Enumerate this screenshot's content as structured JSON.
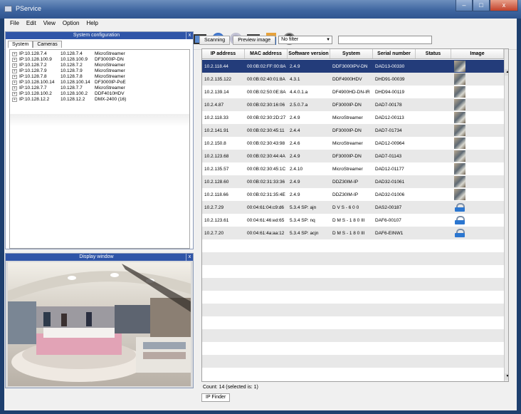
{
  "window": {
    "title": "PService",
    "min": "–",
    "max": "□",
    "close": "x"
  },
  "menu": [
    "File",
    "Edit",
    "View",
    "Option",
    "Help"
  ],
  "toolbar_icons": [
    "save-icon",
    "new-document-icon",
    "cancel-icon",
    "pencil-icon",
    "lines-icon",
    "camera-icon",
    "robot-arm-icon",
    "satellite-icon",
    "network-icon",
    "display-icon",
    "monitor-icon",
    "globe-icon",
    "disc-icon",
    "computer-icon",
    "ip-icon",
    "power-icon"
  ],
  "system_panel": {
    "title": "System configuration",
    "close": "x",
    "tabs": [
      "System",
      "Cameras"
    ],
    "tree": [
      {
        "c1": "IP:10.128.7.4",
        "c2": "10.128.7.4",
        "c3": "MicroStreamer"
      },
      {
        "c1": "IP:10.128.100.9",
        "c2": "10.128.100.9",
        "c3": "DF3000IP-DN"
      },
      {
        "c1": "IP:10.128.7.2",
        "c2": "10.128.7.2",
        "c3": "MicroStreamer"
      },
      {
        "c1": "IP:10.128.7.9",
        "c2": "10.128.7.9",
        "c3": "MicroStreamer"
      },
      {
        "c1": "IP:10.128.7.8",
        "c2": "10.128.7.8",
        "c3": "MicroStreamer"
      },
      {
        "c1": "IP:10.128.100.14",
        "c2": "10.128.100.14",
        "c3": "DF3000IP-PoE"
      },
      {
        "c1": "IP:10.128.7.7",
        "c2": "10.128.7.7",
        "c3": "MicroStreamer"
      },
      {
        "c1": "IP:10.128.100.2",
        "c2": "10.128.100.2",
        "c3": "DDF4010HDV"
      },
      {
        "c1": "IP:10.128.12.2",
        "c2": "10.128.12.2",
        "c3": "DMX-2400 (16)"
      }
    ]
  },
  "display_panel": {
    "title": "Display window",
    "close": "x"
  },
  "controls": {
    "scanning": "Scanning",
    "preview": "Preview image",
    "filter": "No filter",
    "filter_arrow": "▼"
  },
  "table": {
    "columns": [
      "IP address",
      "MAC address",
      "Software version",
      "System",
      "Serial number",
      "Status",
      "Image"
    ],
    "rows": [
      {
        "ip": "10.2.118.44",
        "mac": "00:0B:02:FF:00:8A",
        "sw": "2.4.9",
        "system": "DDF3000IPV-DN",
        "serial": "DAD13-00330",
        "status": "",
        "img": "thumb"
      },
      {
        "ip": "10.2.135.122",
        "mac": "00:0B:02:40:01:8A",
        "sw": "4.3.1",
        "system": "DDF4900HDV",
        "serial": "DHD91-00039",
        "status": "",
        "img": "thumb"
      },
      {
        "ip": "10.2.139.14",
        "mac": "00:0B:02:50:0E:8A",
        "sw": "4.4.0.1.a",
        "system": "DF4900HD-DN-IR",
        "serial": "DHD94-00119",
        "status": "",
        "img": "thumb"
      },
      {
        "ip": "10.2.4.87",
        "mac": "00:0B:02:30:16:06",
        "sw": "2.5.0.7.a",
        "system": "DF3000IP-DN",
        "serial": "DAD7-00178",
        "status": "",
        "img": "thumb"
      },
      {
        "ip": "10.2.118.33",
        "mac": "00:0B:02:30:2D:27",
        "sw": "2.4.9",
        "system": "MicroStreamer",
        "serial": "DAD12-00113",
        "status": "",
        "img": "thumb"
      },
      {
        "ip": "10.2.141.91",
        "mac": "00:0B:02:30:45:11",
        "sw": "2.4.4",
        "system": "DF3000IP-DN",
        "serial": "DAD7-01734",
        "status": "",
        "img": "thumb"
      },
      {
        "ip": "10.2.150.8",
        "mac": "00:0B:02:30:43:98",
        "sw": "2.4.6",
        "system": "MicroStreamer",
        "serial": "DAD12-00964",
        "status": "",
        "img": "thumb"
      },
      {
        "ip": "10.2.123.68",
        "mac": "00:0B:02:30:44:4A",
        "sw": "2.4.9",
        "system": "DF3000IP-DN",
        "serial": "DAD7-01143",
        "status": "",
        "img": "thumb"
      },
      {
        "ip": "10.2.135.57",
        "mac": "00:0B:02:30:45:1C",
        "sw": "2.4.10",
        "system": "MicroStreamer",
        "serial": "DAD12-01177",
        "status": "",
        "img": "thumb"
      },
      {
        "ip": "10.2.128.60",
        "mac": "00:0B:02:31:33:36",
        "sw": "2.4.9",
        "system": "DDZ30IM-IP",
        "serial": "DAD32-01061",
        "status": "",
        "img": "thumb"
      },
      {
        "ip": "10.2.118.66",
        "mac": "00:0B:02:31:35:4E",
        "sw": "2.4.9",
        "system": "DDZ30IM-IP",
        "serial": "DAD32-01006",
        "status": "",
        "img": "thumb"
      },
      {
        "ip": "10.2.7.29",
        "mac": "00:04:61:04:c9:d6",
        "sw": "5.3.4 SP: ajn",
        "system": "D V S - 6 0 0",
        "serial": "DAS2-00187",
        "status": "",
        "img": "lock"
      },
      {
        "ip": "10.2.123.61",
        "mac": "00:04:61:46:ed:65",
        "sw": "5.3.4 SP: nq",
        "system": "D M S - 1 8 0 III",
        "serial": "DAF6-00107",
        "status": "",
        "img": "lock"
      },
      {
        "ip": "10.2.7.20",
        "mac": "00:04:61:4a:aa:12",
        "sw": "5.3.4 SP: acjn",
        "system": "D M S - 1 8 0 III",
        "serial": "DAF6-EINW1",
        "status": "",
        "img": "lock"
      }
    ]
  },
  "scroll": {
    "up": "▲",
    "down": "▼"
  },
  "status": "Count: 14 (selected is: 1)",
  "bottom_tab": "IP Finder",
  "colors": {
    "selection": "#233c7a",
    "panel_header": "#2f55a8"
  }
}
